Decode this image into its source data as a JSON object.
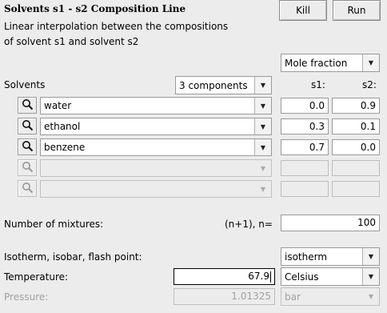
{
  "header": {
    "title": "Solvents s1 - s2 Composition Line",
    "kill_label": "Kill",
    "run_label": "Run",
    "description_line1": "Linear interpolation between the compositions",
    "description_line2": "of solvent s1 and solvent s2"
  },
  "composition_unit": {
    "selected": "Mole fraction"
  },
  "solvents": {
    "label": "Solvents",
    "count_selected": "3 components",
    "col_s1": "s1:",
    "col_s2": "s2:",
    "rows": [
      {
        "name": "water",
        "s1": "0.0",
        "s2": "0.9"
      },
      {
        "name": "ethanol",
        "s1": "0.3",
        "s2": "0.1"
      },
      {
        "name": "benzene",
        "s1": "0.7",
        "s2": "0.0"
      },
      {
        "name": "",
        "s1": "",
        "s2": ""
      },
      {
        "name": "",
        "s1": "",
        "s2": ""
      }
    ]
  },
  "mixtures": {
    "label": "Number of mixtures:",
    "formula": "(n+1), n=",
    "value": "100"
  },
  "conditions": {
    "label": "Isotherm, isobar, flash point:",
    "selected": "isotherm",
    "temperature_label": "Temperature:",
    "temperature_value": "67.9",
    "temperature_unit": "Celsius",
    "pressure_label": "Pressure:",
    "pressure_value": "1.01325",
    "pressure_unit": "bar"
  },
  "icons": {
    "search": "magnifier-icon",
    "dropdown": "chevron-down-icon"
  }
}
